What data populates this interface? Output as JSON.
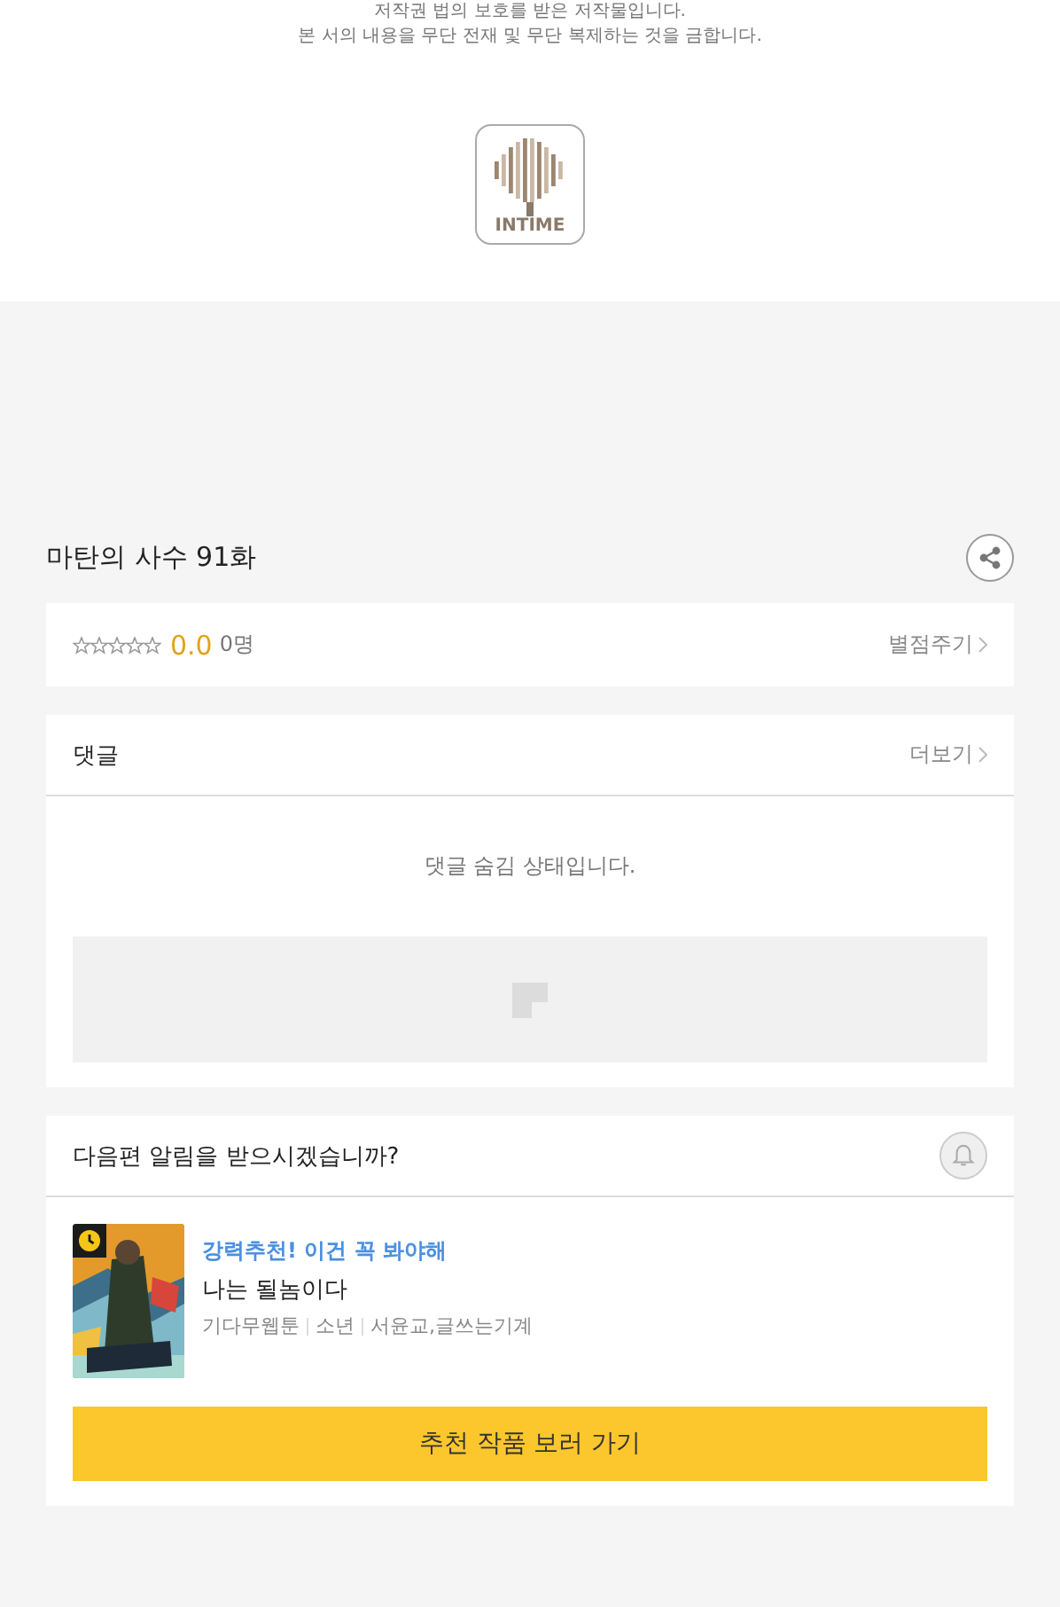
{
  "notice": {
    "lines": [
      "저작권 법의 보호를 받은 저작물입니다.",
      "본 서의 내용을 무단 전재 및 무단 복제하는 것을 금합니다."
    ]
  },
  "logo": {
    "text": "INTIME"
  },
  "episode": {
    "title": "마탄의 사수 91화"
  },
  "rating": {
    "stars": 0,
    "score": "0.0",
    "count": "0명",
    "action": "별점주기"
  },
  "comments": {
    "title": "댓글",
    "more": "더보기",
    "message": "댓글 숨김 상태입니다."
  },
  "notification": {
    "question": "다음편 알림을 받으시겠습니까?"
  },
  "recommendation": {
    "tagline": "강력추천! 이건 꼭 봐야해",
    "title": "나는 될놈이다",
    "meta": [
      "기다무웹툰",
      "소년",
      "서윤교,글쓰는기계"
    ],
    "button": "추천 작품 보러 가기"
  }
}
